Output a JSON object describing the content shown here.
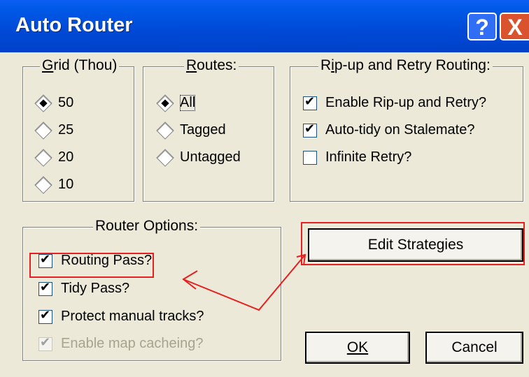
{
  "window": {
    "title": "Auto Router",
    "help_glyph": "?",
    "close_glyph": "X"
  },
  "grid": {
    "title": "Grid (Thou)",
    "options": [
      "50",
      "25",
      "20",
      "10"
    ],
    "selected": "50"
  },
  "routes": {
    "title": "Routes:",
    "options": [
      "All",
      "Tagged",
      "Untagged"
    ],
    "selected": "All"
  },
  "ripup": {
    "title": "Rip-up and Retry Routing:",
    "items": [
      {
        "label": "Enable Rip-up and Retry?",
        "checked": true
      },
      {
        "label": "Auto-tidy on Stalemate?",
        "checked": true
      },
      {
        "label": "Infinite Retry?",
        "checked": false
      }
    ]
  },
  "router_options": {
    "title": "Router Options:",
    "items": [
      {
        "label": "Routing Pass?",
        "checked": true,
        "enabled": true
      },
      {
        "label": "Tidy Pass?",
        "checked": true,
        "enabled": true
      },
      {
        "label": "Protect manual tracks?",
        "checked": true,
        "enabled": true
      },
      {
        "label": "Enable map cacheing?",
        "checked": true,
        "enabled": false
      }
    ]
  },
  "buttons": {
    "edit_strategies": "Edit Strategies",
    "ok": "OK",
    "cancel": "Cancel"
  },
  "annotation_color": "#e62020"
}
